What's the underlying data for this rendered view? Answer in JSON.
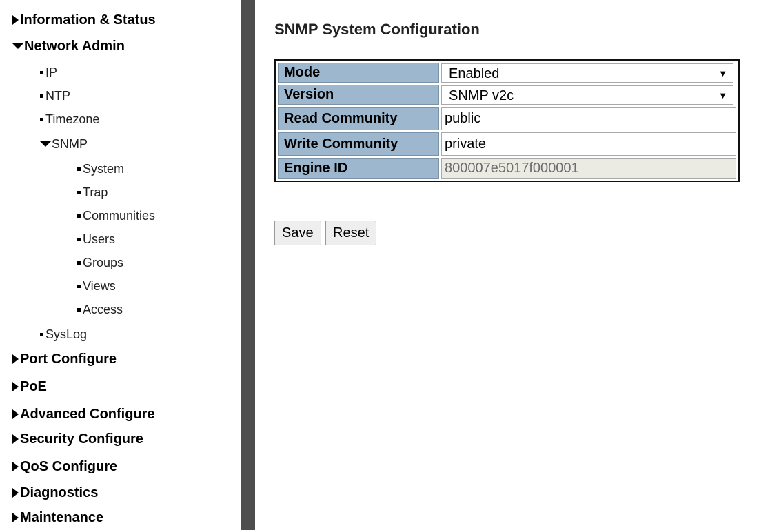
{
  "sidebar": {
    "items": [
      {
        "label": "Information & Status",
        "level": 0,
        "marker": "collapsed"
      },
      {
        "label": "Network Admin",
        "level": 0,
        "marker": "expanded"
      },
      {
        "label": "IP",
        "level": 1,
        "marker": "bullet"
      },
      {
        "label": "NTP",
        "level": 1,
        "marker": "bullet"
      },
      {
        "label": "Timezone",
        "level": 1,
        "marker": "bullet"
      },
      {
        "label": "SNMP",
        "level": 1,
        "marker": "expanded"
      },
      {
        "label": "System",
        "level": 2,
        "marker": "bullet"
      },
      {
        "label": "Trap",
        "level": 2,
        "marker": "bullet"
      },
      {
        "label": "Communities",
        "level": 2,
        "marker": "bullet"
      },
      {
        "label": "Users",
        "level": 2,
        "marker": "bullet"
      },
      {
        "label": "Groups",
        "level": 2,
        "marker": "bullet"
      },
      {
        "label": "Views",
        "level": 2,
        "marker": "bullet"
      },
      {
        "label": "Access",
        "level": 2,
        "marker": "bullet"
      },
      {
        "label": "SysLog",
        "level": 1,
        "marker": "bullet"
      },
      {
        "label": "Port Configure",
        "level": 0,
        "marker": "collapsed"
      },
      {
        "label": "PoE",
        "level": 0,
        "marker": "collapsed"
      },
      {
        "label": "Advanced Configure",
        "level": 0,
        "marker": "collapsed"
      },
      {
        "label": "Security Configure",
        "level": 0,
        "marker": "collapsed"
      },
      {
        "label": "QoS Configure",
        "level": 0,
        "marker": "collapsed"
      },
      {
        "label": "Diagnostics",
        "level": 0,
        "marker": "collapsed"
      },
      {
        "label": "Maintenance",
        "level": 0,
        "marker": "collapsed"
      }
    ]
  },
  "main": {
    "title": "SNMP System Configuration",
    "fields": {
      "mode": {
        "label": "Mode",
        "value": "Enabled"
      },
      "version": {
        "label": "Version",
        "value": "SNMP v2c"
      },
      "read_community": {
        "label": "Read Community",
        "value": "public"
      },
      "write_community": {
        "label": "Write Community",
        "value": "private"
      },
      "engine_id": {
        "label": "Engine ID",
        "value": "800007e5017f000001"
      }
    },
    "buttons": {
      "save": "Save",
      "reset": "Reset"
    }
  },
  "colors": {
    "label_bg": "#9db7cf",
    "sidebar_bar": "#4e4e4e",
    "readonly_bg": "#ebebe4"
  },
  "icons": {
    "collapsed": "triangle-right-icon",
    "expanded": "triangle-down-icon",
    "bullet": "square-bullet-icon",
    "select": "dropdown-arrow-icon"
  }
}
